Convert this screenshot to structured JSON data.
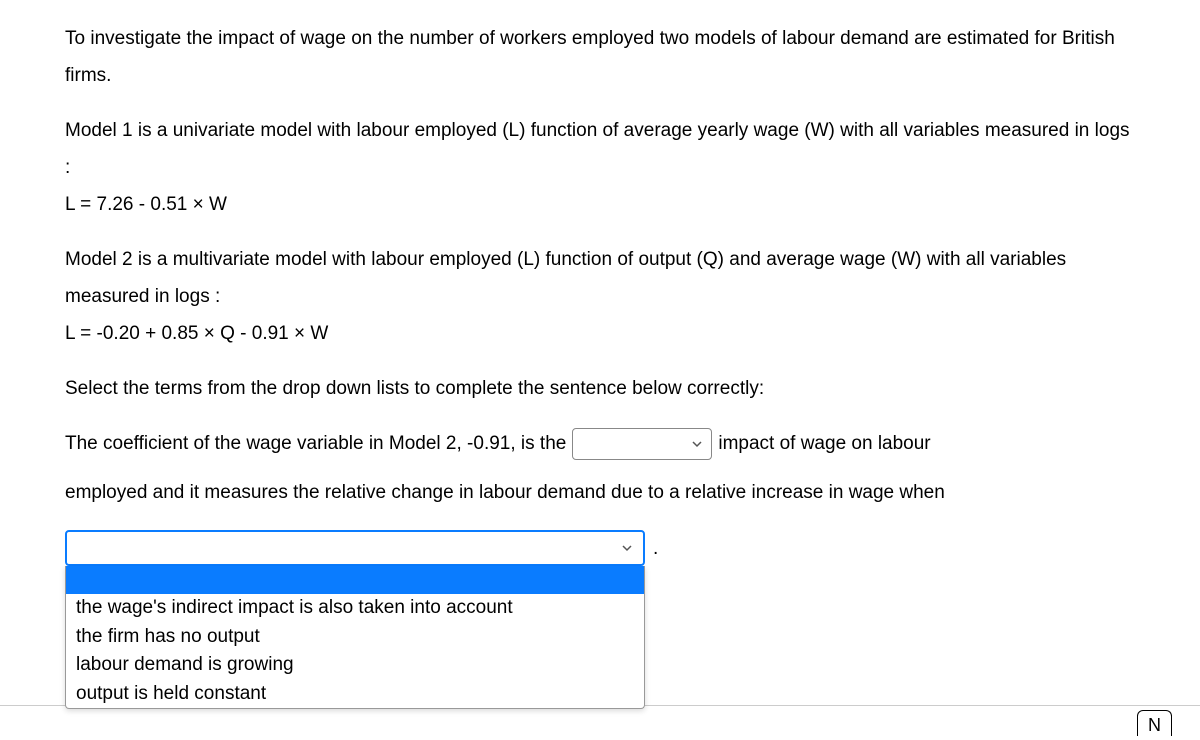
{
  "body": {
    "p1": "To investigate the impact of wage on the number of workers employed two models of labour demand are estimated for British firms.",
    "p2": "Model 1 is a univariate model with labour employed (L) function of average yearly wage (W) with all variables measured in logs :",
    "eq1": "L = 7.26 - 0.51 × W",
    "p3": "Model 2 is a multivariate model with labour employed (L) function of output (Q) and average wage (W) with all variables measured in logs :",
    "eq2": "L = -0.20 + 0.85 × Q - 0.91 × W",
    "instruction": "Select the terms from the drop down lists to complete the sentence below correctly:",
    "sentence_part1": "The coefficient of the wage variable in Model 2, -0.91, is the",
    "sentence_part2": "impact of wage on labour",
    "sentence_part3": "employed and it measures the relative change in labour demand due to a relative increase in wage when",
    "period": "."
  },
  "dropdown1": {
    "selected": ""
  },
  "dropdown2": {
    "selected": "",
    "options": [
      "",
      "the wage's indirect impact is also taken into account",
      "the firm has no output",
      "labour demand is growing",
      "output is held constant"
    ]
  },
  "nav": {
    "next_fragment": "N"
  }
}
